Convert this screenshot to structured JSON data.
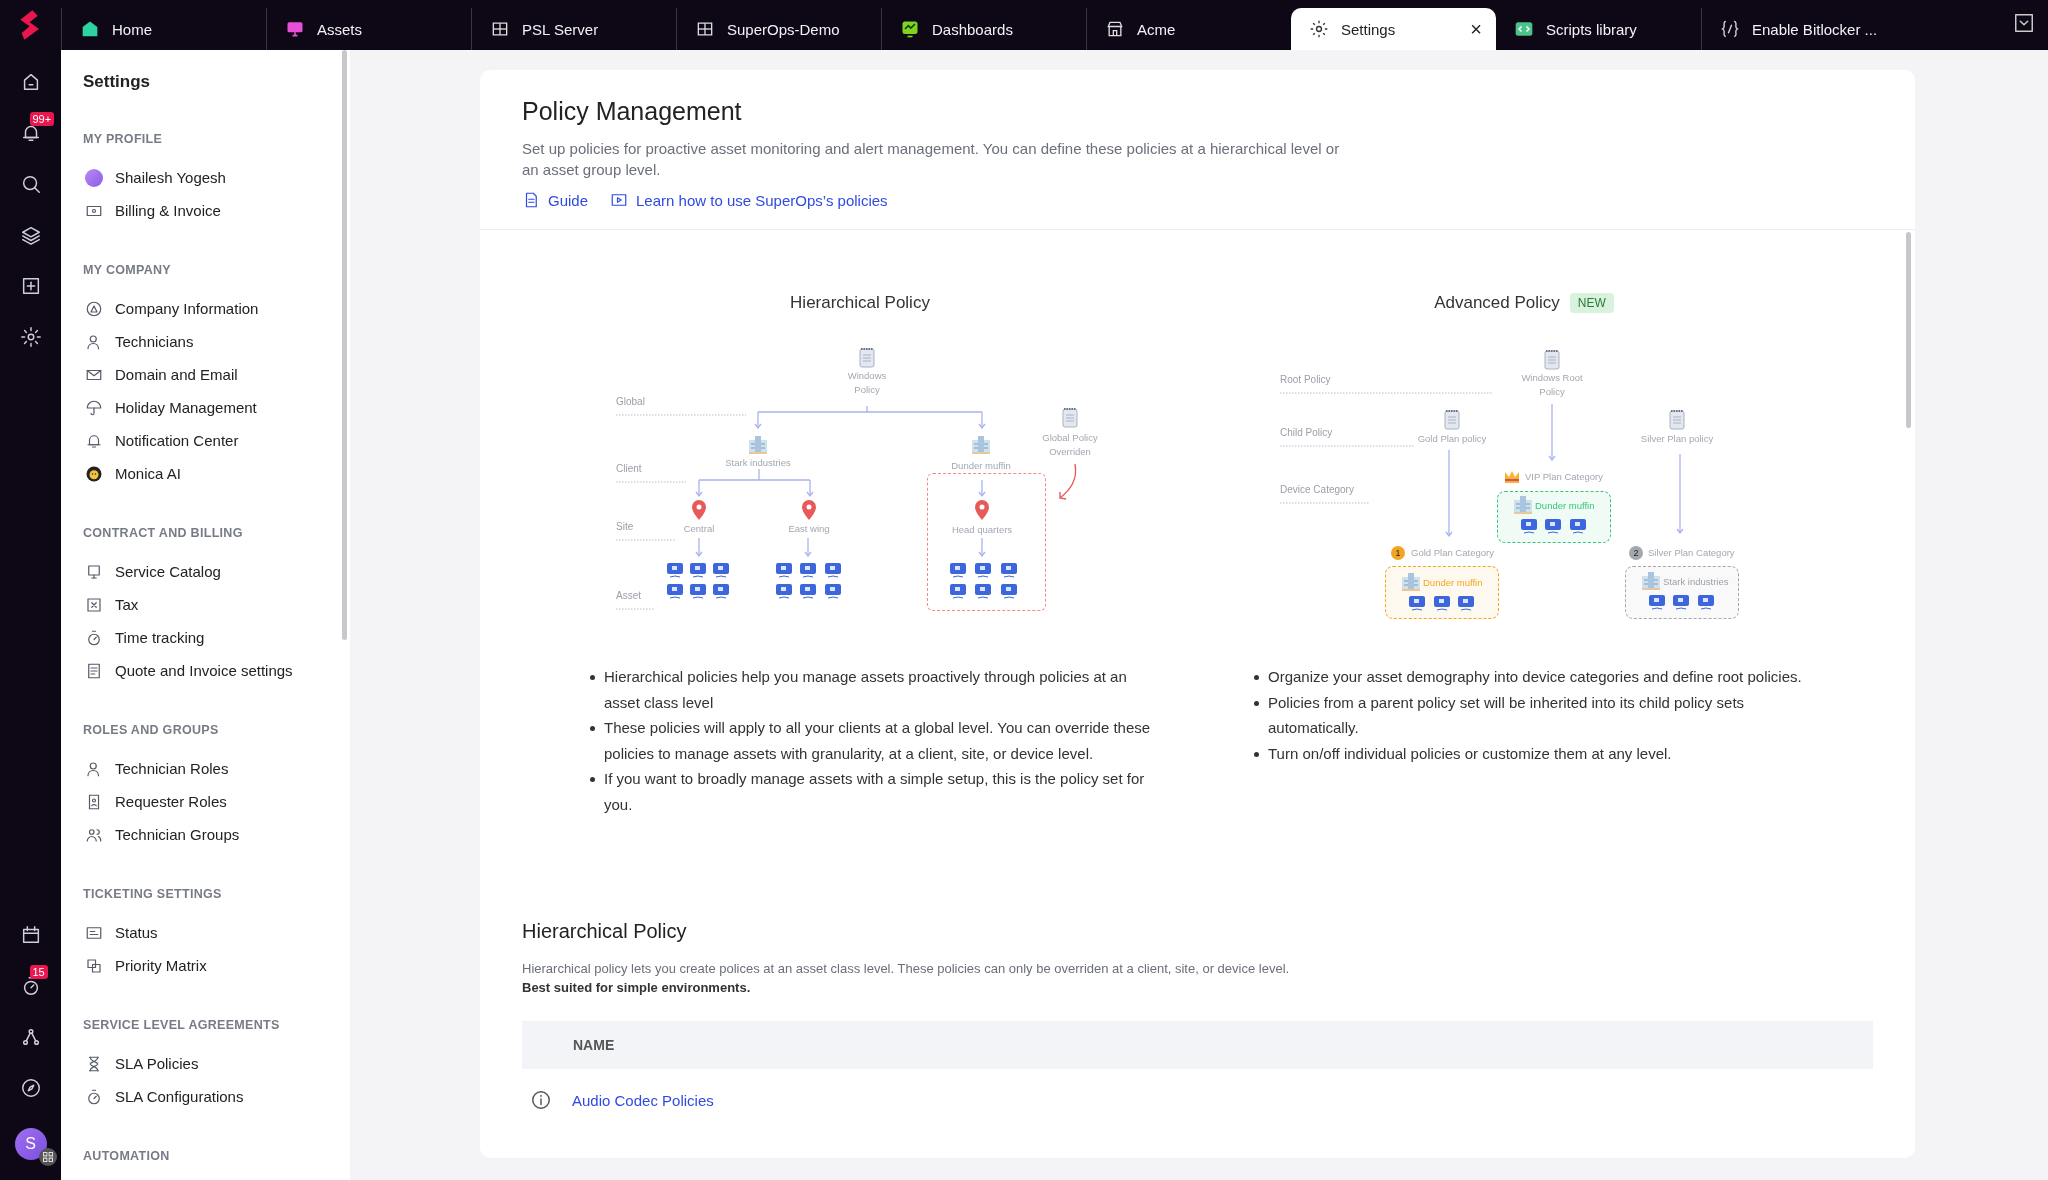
{
  "tabs": [
    {
      "label": "Home",
      "selected": false
    },
    {
      "label": "Assets",
      "selected": false
    },
    {
      "label": "PSL Server",
      "selected": false
    },
    {
      "label": "SuperOps-Demo",
      "selected": false
    },
    {
      "label": "Dashboards",
      "selected": false
    },
    {
      "label": "Acme",
      "selected": false
    },
    {
      "label": "Settings",
      "selected": true,
      "close": "×"
    },
    {
      "label": "Scripts library",
      "selected": false
    },
    {
      "label": "Enable Bitlocker ...",
      "selected": false
    }
  ],
  "rail": {
    "notification_badge": "99+",
    "timer_badge": "15",
    "avatar_initial": "S"
  },
  "sidebar": {
    "title": "Settings",
    "sections": [
      {
        "heading": "MY PROFILE",
        "items": [
          "Shailesh Yogesh",
          "Billing & Invoice"
        ]
      },
      {
        "heading": "MY COMPANY",
        "items": [
          "Company Information",
          "Technicians",
          "Domain and Email",
          "Holiday Management",
          "Notification Center",
          "Monica AI"
        ]
      },
      {
        "heading": "CONTRACT AND BILLING",
        "items": [
          "Service Catalog",
          "Tax",
          "Time tracking",
          "Quote and Invoice settings"
        ]
      },
      {
        "heading": "ROLES AND GROUPS",
        "items": [
          "Technician Roles",
          "Requester Roles",
          "Technician Groups"
        ]
      },
      {
        "heading": "TICKETING SETTINGS",
        "items": [
          "Status",
          "Priority Matrix"
        ]
      },
      {
        "heading": "SERVICE LEVEL AGREEMENTS",
        "items": [
          "SLA Policies",
          "SLA Configurations"
        ]
      },
      {
        "heading": "AUTOMATION"
      }
    ]
  },
  "page": {
    "title": "Policy Management",
    "description": "Set up policies for proactive asset monitoring and alert management. You can define these policies at a hierarchical level or an asset group level.",
    "links": [
      "Guide",
      "Learn how to use SuperOps’s policies"
    ]
  },
  "hierarchical_overview": {
    "title": "Hierarchical Policy",
    "diagram": {
      "levels": [
        "Global",
        "Client",
        "Site",
        "Asset"
      ],
      "nodes": [
        {
          "kind": "policy",
          "label": "Windows Policy"
        },
        {
          "kind": "client",
          "label": "Stark industries"
        },
        {
          "kind": "client",
          "label": "Dunder muffin"
        },
        {
          "kind": "site",
          "label": "Central"
        },
        {
          "kind": "site",
          "label": "East wing"
        },
        {
          "kind": "site",
          "label": "Head quarters"
        },
        {
          "kind": "override",
          "label": "Global Policy Overriden"
        }
      ]
    },
    "bullets": [
      "Hierarchical policies help you manage assets proactively through policies at an asset class level",
      "These policies will apply to all your clients at a global level. You can override these policies to manage assets with granularity, at a client, site, or device level.",
      "If you want to broadly manage assets with a simple setup, this is the policy set for you."
    ]
  },
  "advanced_overview": {
    "title": "Advanced Policy",
    "badge": "NEW",
    "diagram": {
      "levels": [
        "Root Policy",
        "Child Policy",
        "Device Category"
      ],
      "policies": [
        "Windows Root Policy",
        "Gold Plan policy",
        "Silver Plan policy"
      ],
      "categories": [
        {
          "kind": "crown",
          "label": "VIP Plan Category",
          "client": "Dunder muffin",
          "color": "#34c77b"
        },
        {
          "kind": "number",
          "badge": "1",
          "label": "Gold Plan Category",
          "client": "Dunder muffin",
          "color": "#f2a521"
        },
        {
          "kind": "number",
          "badge": "2",
          "label": "Silver Plan Category",
          "client": "Stark industries",
          "color": "#a3a8b0"
        }
      ]
    },
    "bullets": [
      "Organize your asset demography into device categories and define root policies.",
      "Policies from a parent policy set will be inherited into its child policy sets automatically.",
      "Turn on/off individual policies or customize them at any level."
    ]
  },
  "hierarchical_section": {
    "title": "Hierarchical Policy",
    "description": "Hierarchical policy lets you create polices at an asset class level. These policies can only be overriden at a client, site, or device level.",
    "note": "Best suited for simple environments.",
    "table": {
      "columns": [
        "NAME"
      ],
      "rows": [
        {
          "name": "Audio Codec Policies"
        }
      ]
    }
  }
}
